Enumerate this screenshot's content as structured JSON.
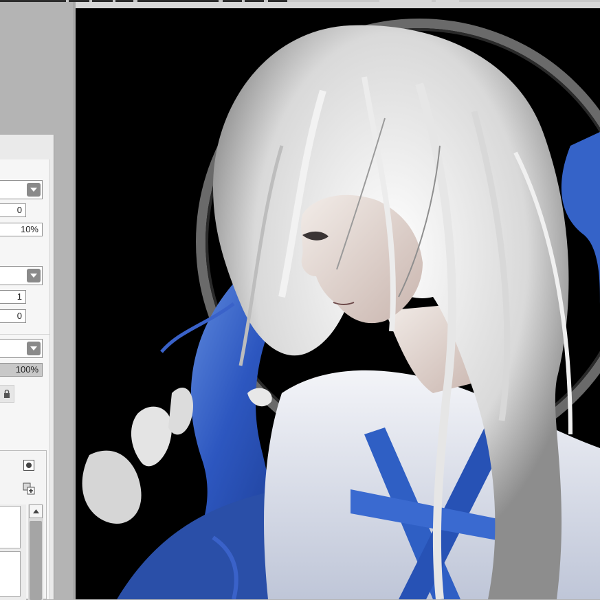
{
  "toolbar": {
    "buttons": [
      "zoom-out",
      "zoom-in",
      "rotate-left",
      "rotate-right",
      "flip",
      "reset-view"
    ]
  },
  "tool_properties": {
    "blend_mode_1": "",
    "field_1": "0",
    "field_2": "10%",
    "blend_mode_2": "",
    "field_3": "1",
    "field_4": "0",
    "blend_mode_3": "",
    "opacity": "100%"
  },
  "layer_panel": {
    "icons": [
      "record-icon",
      "new-layer-icon"
    ]
  },
  "canvas": {
    "description_icon": "artwork-canvas",
    "colors": {
      "background": "#000000",
      "hair": "#e4e4e4",
      "robe_blue": "#2f5fc4",
      "halo": "#9a9a9a"
    }
  }
}
